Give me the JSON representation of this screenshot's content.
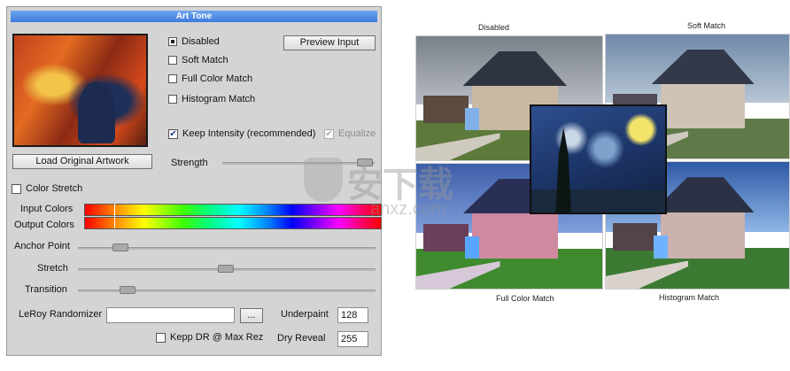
{
  "panel": {
    "title": "Art Tone",
    "preview_button": "Preview Input",
    "load_button": "Load Original Artwork",
    "modes": [
      {
        "label": "Disabled",
        "selected": true
      },
      {
        "label": "Soft Match",
        "selected": false
      },
      {
        "label": "Full Color Match",
        "selected": false
      },
      {
        "label": "Histogram Match",
        "selected": false
      }
    ],
    "keep_intensity": {
      "label": "Keep Intensity (recommended)",
      "checked": true
    },
    "equalize": {
      "label": "Equalize",
      "checked": true,
      "enabled": false
    },
    "strength_label": "Strength",
    "color_stretch": {
      "label": "Color Stretch",
      "checked": false
    },
    "input_colors_label": "Input Colors",
    "output_colors_label": "Output Colors",
    "sliders": [
      {
        "label": "Anchor Point",
        "value": 0.1
      },
      {
        "label": "Stretch",
        "value": 0.5
      },
      {
        "label": "Transition",
        "value": 0.16
      }
    ],
    "randomizer_label": "LeRoy Randomizer",
    "randomizer_value": "",
    "browse_button": "...",
    "underpaint_label": "Underpaint",
    "underpaint_value": "128",
    "kepp_dr": {
      "label": "Kepp DR @ Max Rez",
      "checked": false
    },
    "dry_reveal_label": "Dry Reveal",
    "dry_reveal_value": "255"
  },
  "examples": {
    "captions": [
      "Disabled",
      "Soft Match",
      "Full Color Match",
      "Histogram Match"
    ]
  },
  "watermark": {
    "text": "安下载",
    "sub": "anxz.com"
  },
  "colors": {
    "title_bar": "#3d7bde",
    "panel": "#d4d4d4"
  }
}
